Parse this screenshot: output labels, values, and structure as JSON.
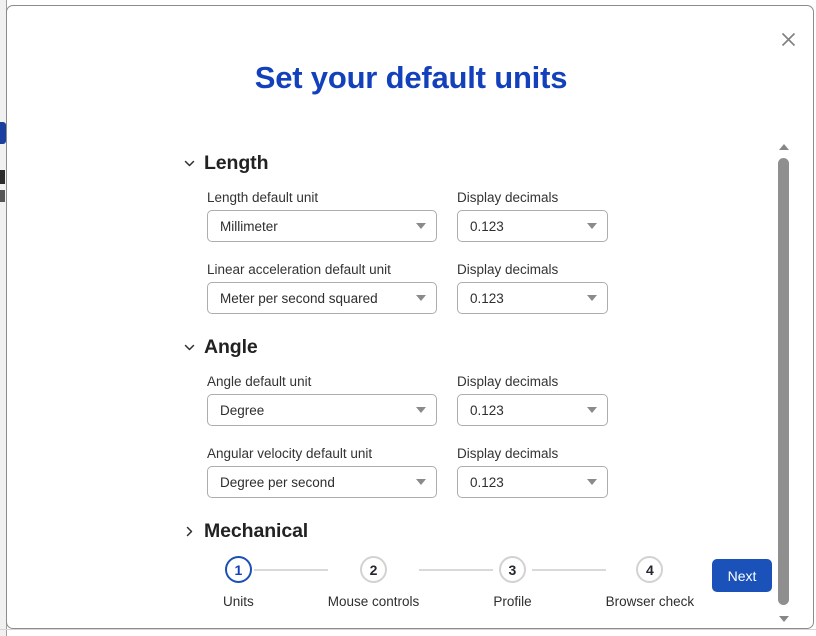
{
  "modal": {
    "title": "Set your default units",
    "close_icon": "close-icon",
    "accent_color": "#1340bb",
    "button_color": "#1a52ba"
  },
  "settings": {
    "groups": [
      {
        "name": "Length",
        "expanded": true,
        "chevron_icon": "chevron-down-icon",
        "rows": [
          {
            "unit_label": "Length default unit",
            "unit_value": "Millimeter",
            "decimals_label": "Display decimals",
            "decimals_value": "0.123"
          },
          {
            "unit_label": "Linear acceleration default unit",
            "unit_value": "Meter per second squared",
            "decimals_label": "Display decimals",
            "decimals_value": "0.123"
          }
        ]
      },
      {
        "name": "Angle",
        "expanded": true,
        "chevron_icon": "chevron-down-icon",
        "rows": [
          {
            "unit_label": "Angle default unit",
            "unit_value": "Degree",
            "decimals_label": "Display decimals",
            "decimals_value": "0.123"
          },
          {
            "unit_label": "Angular velocity default unit",
            "unit_value": "Degree per second",
            "decimals_label": "Display decimals",
            "decimals_value": "0.123"
          }
        ]
      },
      {
        "name": "Mechanical",
        "expanded": false,
        "chevron_icon": "chevron-right-icon",
        "rows": []
      }
    ]
  },
  "stepper": {
    "current": 1,
    "steps": [
      {
        "number": "1",
        "label": "Units"
      },
      {
        "number": "2",
        "label": "Mouse controls"
      },
      {
        "number": "3",
        "label": "Profile"
      },
      {
        "number": "4",
        "label": "Browser check"
      }
    ]
  },
  "footer": {
    "next_label": "Next"
  },
  "scrollbar": {
    "up_icon": "triangle-up-icon",
    "down_icon": "triangle-down-icon"
  }
}
